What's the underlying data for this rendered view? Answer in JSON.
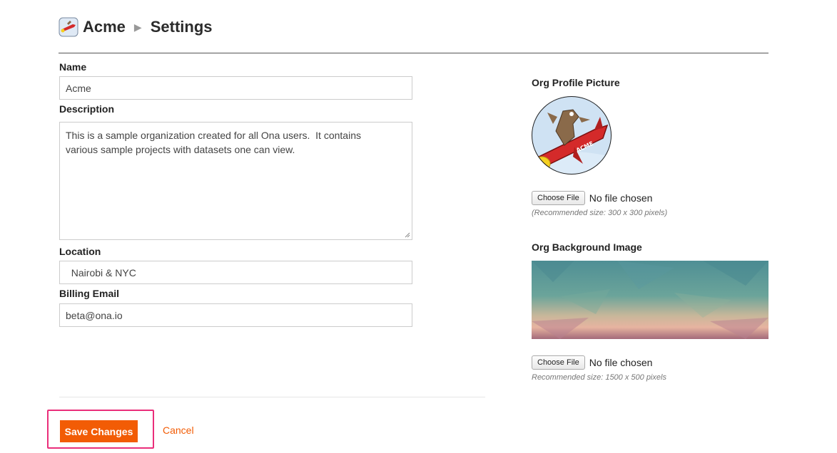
{
  "breadcrumb": {
    "org": "Acme",
    "separator": "▶",
    "page": "Settings"
  },
  "form": {
    "name": {
      "label": "Name",
      "value": "Acme"
    },
    "description": {
      "label": "Description",
      "value": "This is a sample organization created for all Ona users.  It contains\nvarious sample projects with datasets one can view."
    },
    "location": {
      "label": "Location",
      "value": "  Nairobi & NYC"
    },
    "billing_email": {
      "label": "Billing Email",
      "value": "beta@ona.io"
    }
  },
  "profile_picture": {
    "label": "Org Profile Picture",
    "choose_label": "Choose File",
    "status": "No file chosen",
    "hint": "(Recommended size: 300 x 300 pixels)",
    "logo_text": "ACME"
  },
  "background_image": {
    "label": "Org Background Image",
    "choose_label": "Choose File",
    "status": "No file chosen",
    "hint": "Recommended size: 1500 x 500 pixels"
  },
  "actions": {
    "save_label": "Save Changes",
    "cancel_label": "Cancel"
  },
  "colors": {
    "accent": "#f25c05",
    "highlight": "#ea2e7a"
  }
}
